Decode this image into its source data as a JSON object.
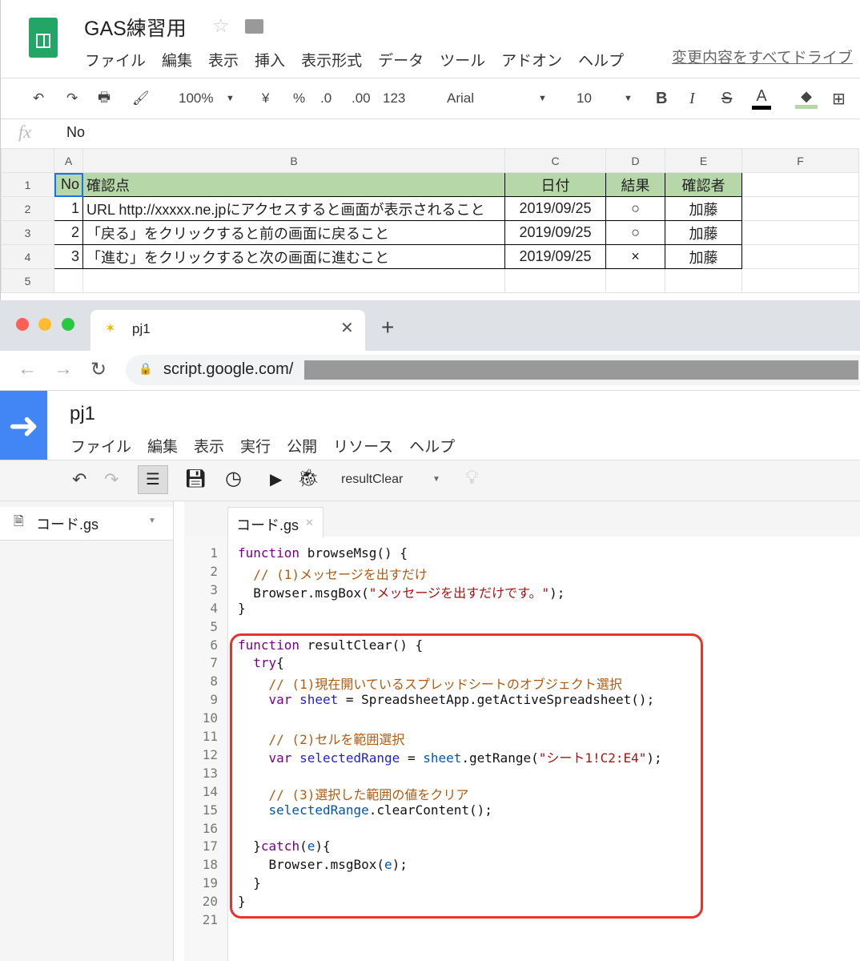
{
  "sheets": {
    "title": "GAS練習用",
    "menu": [
      "ファイル",
      "編集",
      "表示",
      "挿入",
      "表示形式",
      "データ",
      "ツール",
      "アドオン",
      "ヘルプ"
    ],
    "save_status": "変更内容をすべてドライブ",
    "toolbar": {
      "zoom": "100%",
      "currency": "¥",
      "percent": "%",
      "dec_less": ".0",
      "dec_more": ".00",
      "format": "123",
      "font": "Arial",
      "size": "10",
      "bold": "B",
      "italic": "I",
      "strike": "S",
      "textcolor": "A"
    },
    "formula": {
      "fx": "fx",
      "value": "No"
    },
    "columns": [
      "A",
      "B",
      "C",
      "D",
      "E",
      "F"
    ],
    "rows": [
      [
        "1",
        "No",
        "確認点",
        "日付",
        "結果",
        "確認者"
      ],
      [
        "2",
        "1",
        "URL http://xxxxx.ne.jpにアクセスすると画面が表示されること",
        "2019/09/25",
        "○",
        "加藤"
      ],
      [
        "3",
        "2",
        "「戻る」をクリックすると前の画面に戻ること",
        "2019/09/25",
        "○",
        "加藤"
      ],
      [
        "4",
        "3",
        "「進む」をクリックすると次の画面に進むこと",
        "2019/09/25",
        "×",
        "加藤"
      ],
      [
        "5",
        "",
        "",
        "",
        "",
        ""
      ]
    ],
    "header_color": "#b6d7a8"
  },
  "browser": {
    "tab_title": "pj1",
    "url": "script.google.com/"
  },
  "editor": {
    "project": "pj1",
    "menu": [
      "ファイル",
      "編集",
      "表示",
      "実行",
      "公開",
      "リソース",
      "ヘルプ"
    ],
    "function_select": "resultClear",
    "file": "コード.gs",
    "tab": "コード.gs",
    "lines": [
      [
        [
          "kw",
          "function"
        ],
        [
          "def",
          " browseMsg() {"
        ]
      ],
      [
        [
          "cm",
          "  // (1)メッセージを出すだけ"
        ]
      ],
      [
        [
          "def",
          "  Browser.msgBox("
        ],
        [
          "str",
          "\"メッセージを出すだけです。\""
        ],
        [
          "def",
          ");"
        ]
      ],
      [
        [
          "def",
          "}"
        ]
      ],
      [],
      [
        [
          "kw",
          "function"
        ],
        [
          "def",
          " resultClear() {"
        ]
      ],
      [
        [
          "kw",
          "  try"
        ],
        [
          "def",
          "{"
        ]
      ],
      [
        [
          "cm",
          "    // (1)現在開いているスプレッドシートのオブジェクト選択"
        ]
      ],
      [
        [
          "kw",
          "    var"
        ],
        [
          "def",
          " "
        ],
        [
          "var",
          "sheet"
        ],
        [
          "def",
          " = SpreadsheetApp.getActiveSpreadsheet();"
        ]
      ],
      [],
      [
        [
          "cm",
          "    // (2)セルを範囲選択"
        ]
      ],
      [
        [
          "kw",
          "    var"
        ],
        [
          "def",
          " "
        ],
        [
          "var",
          "selectedRange"
        ],
        [
          "def",
          " = "
        ],
        [
          "v2",
          "sheet"
        ],
        [
          "def",
          ".getRange("
        ],
        [
          "str",
          "\"シート1!C2:E4\""
        ],
        [
          "def",
          ");"
        ]
      ],
      [],
      [
        [
          "cm",
          "    // (3)選択した範囲の値をクリア"
        ]
      ],
      [
        [
          "v2",
          "    selectedRange"
        ],
        [
          "def",
          ".clearContent();"
        ]
      ],
      [],
      [
        [
          "def",
          "  }"
        ],
        [
          "kw",
          "catch"
        ],
        [
          "def",
          "("
        ],
        [
          "v2",
          "e"
        ],
        [
          "def",
          "){"
        ]
      ],
      [
        [
          "def",
          "    Browser.msgBox("
        ],
        [
          "v2",
          "e"
        ],
        [
          "def",
          ");"
        ]
      ],
      [
        [
          "def",
          "  }"
        ]
      ],
      [
        [
          "def",
          "}"
        ]
      ],
      []
    ],
    "highlight_color": "#e8322a"
  }
}
